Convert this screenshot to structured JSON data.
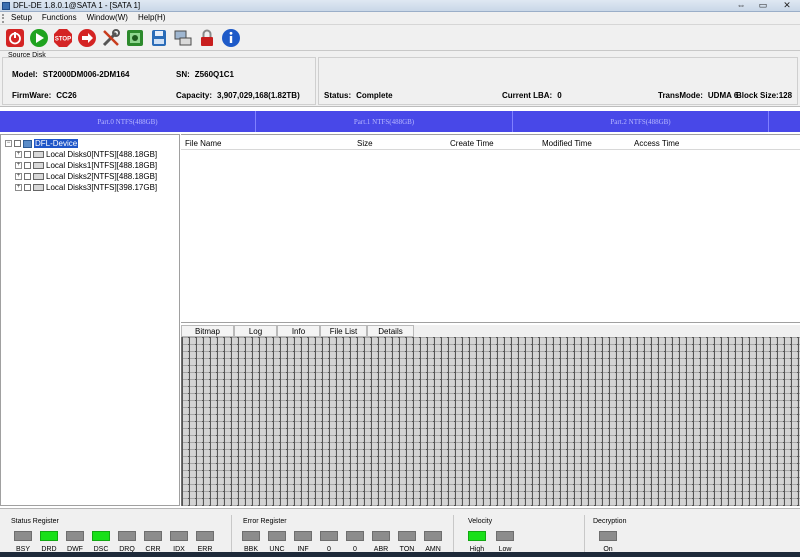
{
  "window": {
    "title": "DFL-DE 1.8.0.1@SATA 1 - [SATA 1]",
    "controls": {
      "minimize": "⇔",
      "maximize": "▭",
      "close": "✕"
    }
  },
  "menu": [
    "Setup",
    "Functions",
    "Window(W)",
    "Help(H)"
  ],
  "toolbar": [
    {
      "name": "power-icon",
      "color": "#d42424"
    },
    {
      "name": "play-icon",
      "color": "#1fa31f"
    },
    {
      "name": "stop-icon",
      "color": "#d42424"
    },
    {
      "name": "redo-arrow-icon",
      "color": "#d42424"
    },
    {
      "name": "tools-icon",
      "color": "#555555"
    },
    {
      "name": "image-icon",
      "color": "#2d8a2d"
    },
    {
      "name": "save-disk-icon",
      "color": "#2a6cb8"
    },
    {
      "name": "network-icon",
      "color": "#4a4a4a"
    },
    {
      "name": "lock-icon",
      "color": "#c81e1e"
    },
    {
      "name": "info-icon",
      "color": "#1e5ac8"
    }
  ],
  "source_disk": {
    "group_label": "Source Disk",
    "model_label": "Model:",
    "model_value": "ST2000DM006-2DM164",
    "sn_label": "SN:",
    "sn_value": "Z560Q1C1",
    "firmware_label": "FirmWare:",
    "firmware_value": "CC26",
    "capacity_label": "Capacity:",
    "capacity_value": "3,907,029,168(1.82TB)",
    "status_label": "Status:",
    "status_value": "Complete",
    "current_lba_label": "Current LBA:",
    "current_lba_value": "0",
    "transmode_label": "TransMode:",
    "transmode_value": "UDMA 6",
    "blocksize_label": "Block Size:",
    "blocksize_value": "128"
  },
  "partitions": [
    "Part.0 NTFS(488GB)",
    "Part.1 NTFS(488GB)",
    "Part.2 NTFS(488GB)"
  ],
  "tree": {
    "root": "DFL-Device",
    "items": [
      "Local Disks0[NTFS][488.18GB]",
      "Local Disks1[NTFS][488.18GB]",
      "Local Disks2[NTFS][488.18GB]",
      "Local Disks3[NTFS][398.17GB]"
    ]
  },
  "file_list": {
    "columns": [
      "File Name",
      "Size",
      "Create Time",
      "Modified Time",
      "Access Time"
    ]
  },
  "tabs": [
    "Bitmap",
    "Log",
    "Info",
    "File List",
    "Details"
  ],
  "status_register": {
    "title": "Status Register",
    "leds": [
      {
        "label": "BSY",
        "on": false
      },
      {
        "label": "DRD",
        "on": true
      },
      {
        "label": "DWF",
        "on": false
      },
      {
        "label": "DSC",
        "on": true
      },
      {
        "label": "DRQ",
        "on": false
      },
      {
        "label": "CRR",
        "on": false
      },
      {
        "label": "IDX",
        "on": false
      },
      {
        "label": "ERR",
        "on": false
      }
    ]
  },
  "error_register": {
    "title": "Error Register",
    "leds": [
      {
        "label": "BBK",
        "on": false
      },
      {
        "label": "UNC",
        "on": false
      },
      {
        "label": "INF",
        "on": false
      },
      {
        "label": "0",
        "on": false
      },
      {
        "label": "0",
        "on": false
      },
      {
        "label": "ABR",
        "on": false
      },
      {
        "label": "TON",
        "on": false
      },
      {
        "label": "AMN",
        "on": false
      }
    ]
  },
  "velocity": {
    "title": "Velocity",
    "leds": [
      {
        "label": "High",
        "on": true
      },
      {
        "label": "Low",
        "on": false
      }
    ]
  },
  "decryption": {
    "title": "Decryption",
    "leds": [
      {
        "label": "On",
        "on": false
      }
    ]
  },
  "colors": {
    "partition_bar": "#4848e8",
    "led_on": "#19e019",
    "led_off": "#8c8c8c",
    "tree_selection": "#1e56c8"
  }
}
